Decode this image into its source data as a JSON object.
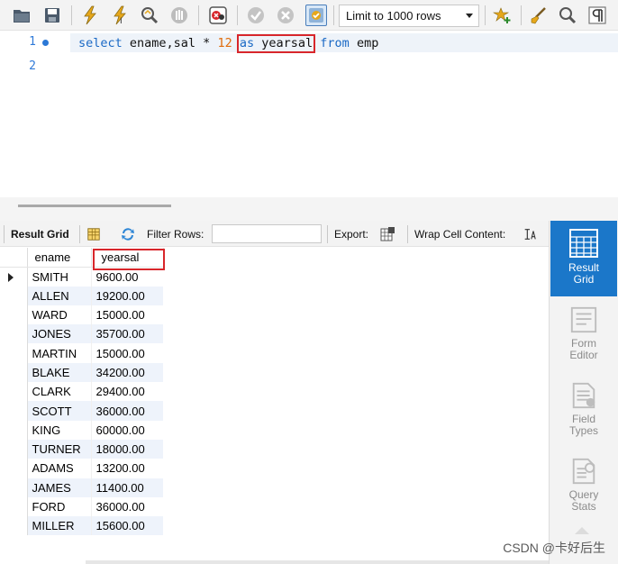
{
  "toolbar": {
    "limit_label": "Limit to 1000 rows",
    "icons": [
      "open-folder-icon",
      "save-icon",
      "execute-icon",
      "execute-current-icon",
      "explain-icon",
      "stop-icon",
      "toggle-error-icon",
      "commit-icon",
      "rollback-icon",
      "autocommit-icon",
      "add-snippet-icon",
      "beautify-icon",
      "find-icon",
      "invisible-chars-icon"
    ]
  },
  "editor": {
    "lines": [
      "1",
      "2"
    ],
    "tokens": {
      "select": "select",
      "cols": " ename,sal * ",
      "num": "12",
      "as": "as",
      "alias": " yearsal",
      "from": "from",
      "table": " emp"
    }
  },
  "result_toolbar": {
    "result_grid": "Result Grid",
    "filter_rows": "Filter Rows:",
    "export": "Export:",
    "wrap": "Wrap Cell Content:"
  },
  "grid": {
    "columns": [
      "ename",
      "yearsal"
    ],
    "rows": [
      [
        "SMITH",
        "9600.00"
      ],
      [
        "ALLEN",
        "19200.00"
      ],
      [
        "WARD",
        "15000.00"
      ],
      [
        "JONES",
        "35700.00"
      ],
      [
        "MARTIN",
        "15000.00"
      ],
      [
        "BLAKE",
        "34200.00"
      ],
      [
        "CLARK",
        "29400.00"
      ],
      [
        "SCOTT",
        "36000.00"
      ],
      [
        "KING",
        "60000.00"
      ],
      [
        "TURNER",
        "18000.00"
      ],
      [
        "ADAMS",
        "13200.00"
      ],
      [
        "JAMES",
        "11400.00"
      ],
      [
        "FORD",
        "36000.00"
      ],
      [
        "MILLER",
        "15600.00"
      ]
    ]
  },
  "side_panel": {
    "result_grid": [
      "Result",
      "Grid"
    ],
    "form_editor": [
      "Form",
      "Editor"
    ],
    "field_types": [
      "Field",
      "Types"
    ],
    "query_stats": [
      "Query",
      "Stats"
    ]
  },
  "watermark": "CSDN @卡好后生",
  "colors": {
    "keyword": "#1a69c5",
    "number": "#e06c0a",
    "highlight": "#d8262b",
    "active_panel": "#1b77c9"
  }
}
